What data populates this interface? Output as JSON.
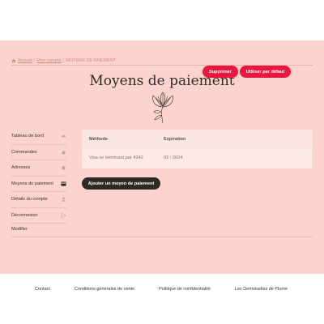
{
  "breadcrumb": {
    "home": "Accueil",
    "account": "Mon compte",
    "current": "MOYENS DE PAIEMENT"
  },
  "page_title": "Moyens de paiement",
  "sidebar": {
    "items": [
      {
        "label": "Tableau de bord",
        "icon": "dashboard-icon"
      },
      {
        "label": "Commandes",
        "icon": "basket-icon"
      },
      {
        "label": "Adresses",
        "icon": "home-icon"
      },
      {
        "label": "Moyens de paiement",
        "icon": "credit-card-icon",
        "active": true
      },
      {
        "label": "Détails du compte",
        "icon": "user-icon"
      },
      {
        "label": "Déconnexion",
        "icon": "logout-icon"
      }
    ],
    "edit_label": "Modifier"
  },
  "table": {
    "headers": {
      "method": "Méthode",
      "expiration": "Expiration"
    },
    "rows": [
      {
        "method": "Visa se terminant par 4242",
        "expiration": "02 / 2024"
      }
    ],
    "delete_label": "Supprimer",
    "default_label": "Utiliser par défaut"
  },
  "add_button": "Ajouter un moyen de paiement",
  "footer": {
    "links": [
      "Contact",
      "Conditions générales de vente",
      "Politique de confidentialité",
      "Les Demoiselles de Plume"
    ]
  },
  "colors": {
    "main_bg": "#fdd3cd",
    "accent_red": "#e8173f",
    "dark_button": "#2d2926"
  }
}
